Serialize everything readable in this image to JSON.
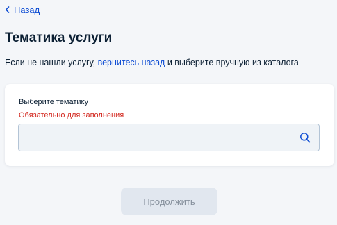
{
  "nav": {
    "back_label": "Назад"
  },
  "page": {
    "title": "Тематика услуги",
    "subtitle_before": "Если не нашли услугу, ",
    "subtitle_link": "вернитесь назад",
    "subtitle_after": " и выберите вручную из каталога"
  },
  "form": {
    "label": "Выберите тематику",
    "error": "Обязательно для заполнения",
    "value": "",
    "placeholder": ""
  },
  "actions": {
    "continue_label": "Продолжить"
  },
  "colors": {
    "accent": "#0d4cd3",
    "error": "#d3281f",
    "text": "#0b1f33",
    "background": "#f4f6f9",
    "button_disabled_bg": "#e1e7ef",
    "button_disabled_text": "#86909c"
  },
  "icons": {
    "back": "chevron-left-icon",
    "search": "search-icon"
  }
}
